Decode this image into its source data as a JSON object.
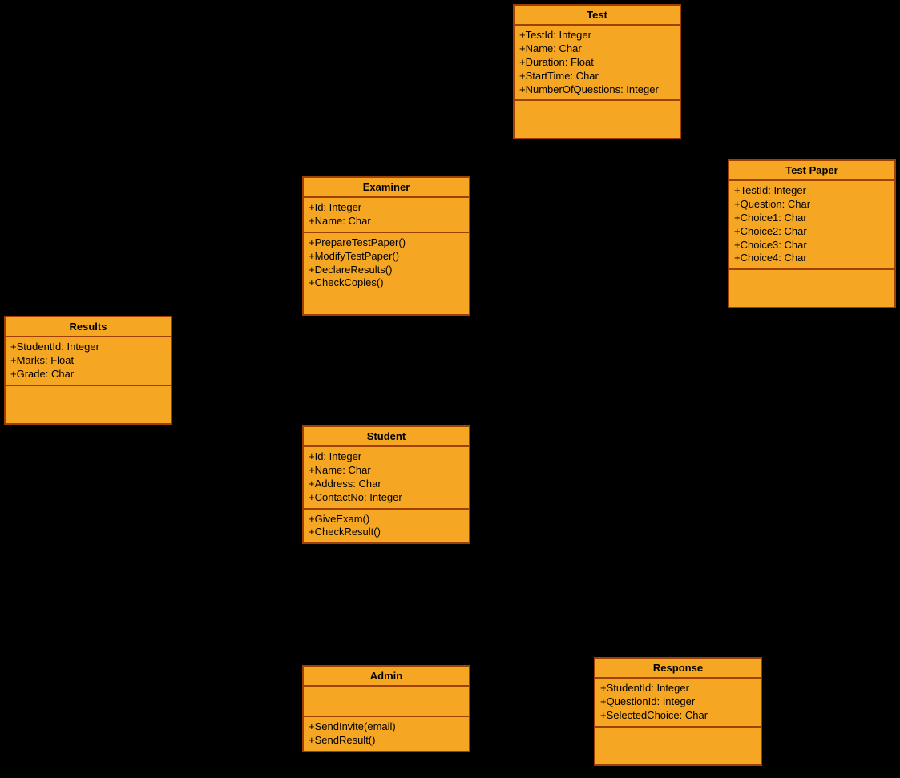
{
  "chart_data": {
    "type": "diagram",
    "diagram_type": "UML class diagram",
    "classes": [
      {
        "name": "Test",
        "attributes": [
          "+TestId: Integer",
          "+Name: Char",
          "+Duration: Float",
          "+StartTime: Char",
          "+NumberOfQuestions: Integer"
        ],
        "methods": []
      },
      {
        "name": "Examiner",
        "attributes": [
          "+Id: Integer",
          "+Name: Char"
        ],
        "methods": [
          "+PrepareTestPaper()",
          "+ModifyTestPaper()",
          "+DeclareResults()",
          "+CheckCopies()"
        ]
      },
      {
        "name": "Test Paper",
        "attributes": [
          "+TestId: Integer",
          "+Question: Char",
          "+Choice1: Char",
          "+Choice2: Char",
          "+Choice3: Char",
          "+Choice4: Char"
        ],
        "methods": []
      },
      {
        "name": "Results",
        "attributes": [
          "+StudentId: Integer",
          "+Marks: Float",
          "+Grade: Char"
        ],
        "methods": []
      },
      {
        "name": "Student",
        "attributes": [
          "+Id: Integer",
          "+Name: Char",
          "+Address: Char",
          "+ContactNo: Integer"
        ],
        "methods": [
          "+GiveExam()",
          "+CheckResult()"
        ]
      },
      {
        "name": "Admin",
        "attributes": [],
        "methods": [
          "+SendInvite(email)",
          "+SendResult()"
        ]
      },
      {
        "name": "Response",
        "attributes": [
          "+StudentId: Integer",
          "+QuestionId: Integer",
          "+SelectedChoice: Char"
        ],
        "methods": []
      }
    ]
  },
  "test": {
    "title": "Test",
    "a0": "+TestId: Integer",
    "a1": "+Name: Char",
    "a2": "+Duration: Float",
    "a3": "+StartTime: Char",
    "a4": "+NumberOfQuestions: Integer"
  },
  "examiner": {
    "title": "Examiner",
    "a0": "+Id: Integer",
    "a1": "+Name: Char",
    "m0": "+PrepareTestPaper()",
    "m1": "+ModifyTestPaper()",
    "m2": "+DeclareResults()",
    "m3": "+CheckCopies()"
  },
  "testpaper": {
    "title": "Test Paper",
    "a0": "+TestId: Integer",
    "a1": "+Question: Char",
    "a2": "+Choice1: Char",
    "a3": "+Choice2: Char",
    "a4": "+Choice3: Char",
    "a5": "+Choice4: Char"
  },
  "results": {
    "title": "Results",
    "a0": "+StudentId: Integer",
    "a1": "+Marks: Float",
    "a2": "+Grade: Char"
  },
  "student": {
    "title": "Student",
    "a0": "+Id: Integer",
    "a1": "+Name: Char",
    "a2": "+Address: Char",
    "a3": "+ContactNo: Integer",
    "m0": "+GiveExam()",
    "m1": "+CheckResult()"
  },
  "admin": {
    "title": "Admin",
    "m0": "+SendInvite(email)",
    "m1": "+SendResult()"
  },
  "response": {
    "title": "Response",
    "a0": "+StudentId: Integer",
    "a1": "+QuestionId: Integer",
    "a2": "+SelectedChoice: Char"
  }
}
